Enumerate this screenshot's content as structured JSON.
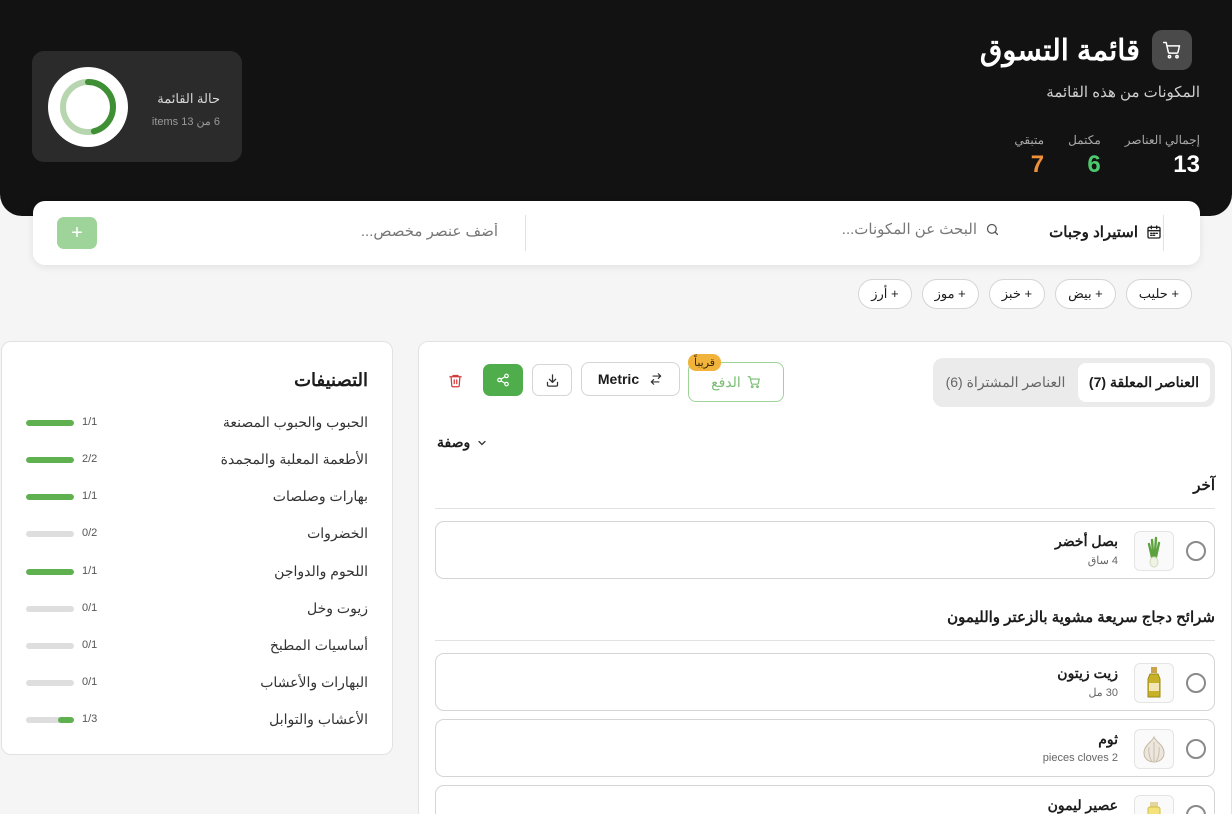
{
  "header": {
    "title": "قائمة التسوق",
    "subtitle": "المكونات من هذه القائمة",
    "stats": {
      "total_label": "إجمالي العناصر",
      "total_value": "13",
      "done_label": "مكتمل",
      "done_value": "6",
      "left_label": "متبقي",
      "left_value": "7"
    },
    "status": {
      "label": "حالة القائمة",
      "progress_text": "6 من 13 items",
      "progress_fraction": 0.4615
    },
    "colors": {
      "done": "#4cc96d",
      "left": "#f0913a",
      "accent": "#4fae4b"
    }
  },
  "toolbar": {
    "import_label": "استيراد وجبات",
    "search_placeholder": "البحث عن المكونات...",
    "custom_placeholder": "أضف عنصر مخصص...",
    "add_label": "+"
  },
  "quick_add": [
    "+ حليب",
    "+ بيض",
    "+ خبز",
    "+ موز",
    "+ أرز"
  ],
  "categories": {
    "title": "التصنيفات",
    "items": [
      {
        "name": "الحبوب والحبوب المصنعة",
        "count": "1/1",
        "fraction": 1
      },
      {
        "name": "الأطعمة المعلبة والمجمدة",
        "count": "2/2",
        "fraction": 1
      },
      {
        "name": "بهارات وصلصات",
        "count": "1/1",
        "fraction": 1
      },
      {
        "name": "الخضروات",
        "count": "0/2",
        "fraction": 0
      },
      {
        "name": "اللحوم والدواجن",
        "count": "1/1",
        "fraction": 1
      },
      {
        "name": "زيوت وخل",
        "count": "0/1",
        "fraction": 0
      },
      {
        "name": "أساسيات المطبخ",
        "count": "0/1",
        "fraction": 0
      },
      {
        "name": "البهارات والأعشاب",
        "count": "0/1",
        "fraction": 0
      },
      {
        "name": "الأعشاب والتوابل",
        "count": "1/3",
        "fraction": 0.333
      }
    ]
  },
  "main": {
    "tab_pending": "العناصر المعلقة (7)",
    "tab_bought": "العناصر المشتراة (6)",
    "pay_label": "الدفع",
    "soon_badge": "قريباً",
    "units_label": "Metric",
    "recipe_label": "وصفة",
    "sections": [
      {
        "title": "آخر",
        "items": [
          {
            "name": "بصل أخضر",
            "qty": "4 ساق",
            "icon": "green-onion-icon"
          }
        ]
      },
      {
        "title": "شرائح دجاج سريعة مشوية بالزعتر والليمون",
        "items": [
          {
            "name": "زيت زيتون",
            "qty": "30 مل",
            "icon": "olive-oil-icon"
          },
          {
            "name": "ثوم",
            "qty": "2 pieces cloves",
            "icon": "garlic-icon"
          },
          {
            "name": "عصير ليمون",
            "qty": "",
            "icon": "lemon-juice-icon"
          }
        ]
      }
    ]
  }
}
